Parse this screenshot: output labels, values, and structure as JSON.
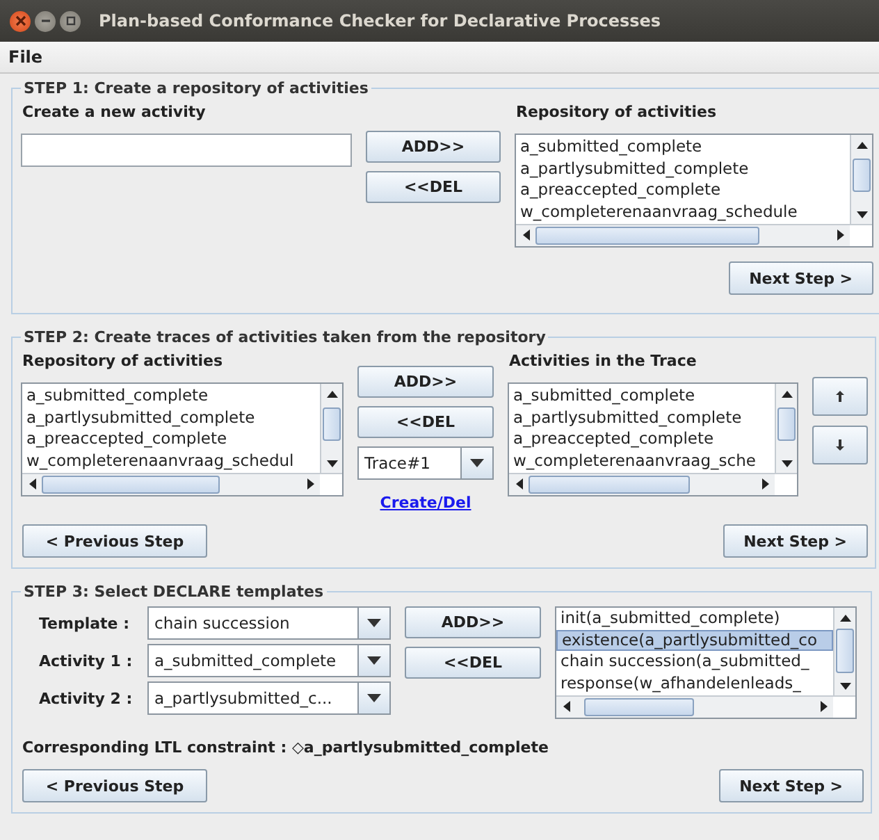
{
  "window": {
    "title": "Plan-based Conformance Checker for Declarative Processes"
  },
  "menu": [
    "File"
  ],
  "step1": {
    "legend": "STEP 1: Create a repository of activities",
    "new_label": "Create a new activity",
    "list_label": "Repository of activities",
    "list": [
      {
        "text": "a_submitted_complete",
        "selected": false
      },
      {
        "text": "a_partlysubmitted_complete",
        "selected": false
      },
      {
        "text": "a_preaccepted_complete",
        "selected": false
      },
      {
        "text": "w_completerenaanvraag_schedule",
        "selected": false
      }
    ],
    "add": "ADD>>",
    "del": "<<DEL",
    "next": "Next Step >"
  },
  "step2": {
    "legend": "STEP 2: Create traces of activities taken from the repository",
    "list_label": "Repository of activities",
    "trace_label": "Activities in the Trace",
    "list": [
      {
        "text": "a_submitted_complete",
        "selected": false
      },
      {
        "text": "a_partlysubmitted_complete",
        "selected": false
      },
      {
        "text": "a_preaccepted_complete",
        "selected": false
      },
      {
        "text": "w_completerenaanvraag_schedul",
        "selected": false
      }
    ],
    "trace": [
      {
        "text": "a_submitted_complete",
        "selected": false
      },
      {
        "text": "a_partlysubmitted_complete",
        "selected": false
      },
      {
        "text": "a_preaccepted_complete",
        "selected": false
      },
      {
        "text": "w_completerenaanvraag_sche",
        "selected": false
      }
    ],
    "add": "ADD>>",
    "del": "<<DEL",
    "trace_select": "Trace#1",
    "link": "Create/Del",
    "previous": "< Previous Step",
    "next": "Next Step >"
  },
  "step3": {
    "legend": "STEP 3: Select DECLARE templates",
    "fields": [
      {
        "label": "Template :",
        "value": "chain succession"
      },
      {
        "label": "Activity 1 :",
        "value": "a_submitted_complete"
      },
      {
        "label": "Activity 2 :",
        "value": "a_partlysubmitted_c..."
      }
    ],
    "add": "ADD>>",
    "del": "<<DEL",
    "constraints": [
      {
        "text": "init(a_submitted_complete)",
        "selected": false
      },
      {
        "text": "existence(a_partlysubmitted_co",
        "selected": true
      },
      {
        "text": "chain succession(a_submitted_",
        "selected": false
      },
      {
        "text": "response(w_afhandelenleads_",
        "selected": false
      }
    ],
    "ltl": "Corresponding LTL constraint : ◇a_partlysubmitted_complete",
    "previous": "< Previous Step",
    "next": "Next Step >"
  }
}
